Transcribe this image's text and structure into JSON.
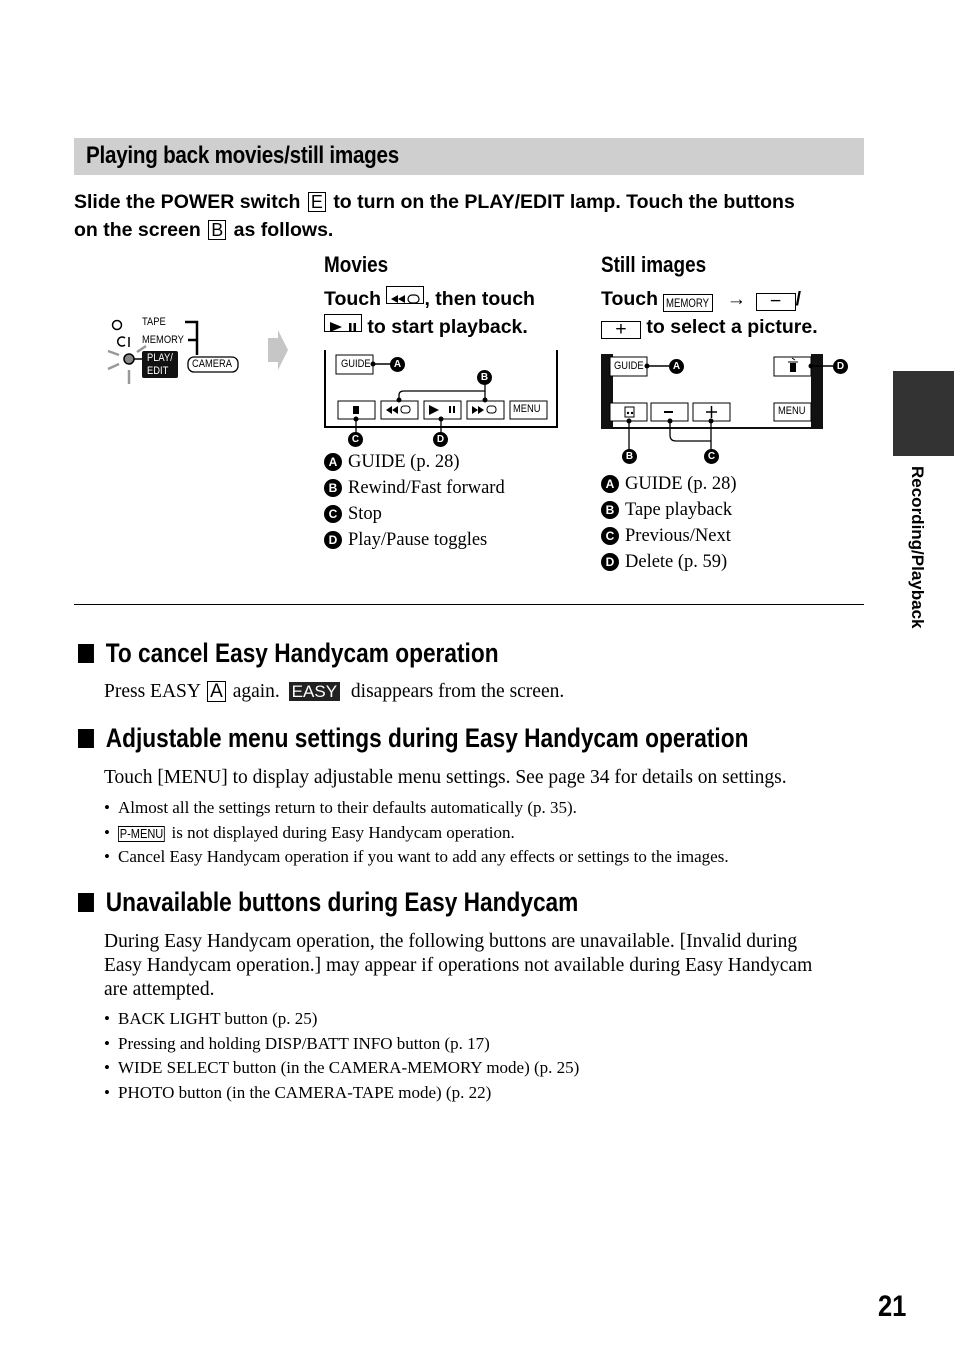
{
  "section": {
    "title": "Playing back movies/still images",
    "intro": {
      "part1": "Slide the POWER switch",
      "key1": "E",
      "part2": "to turn on the PLAY/EDIT lamp. Touch the buttons",
      "part3": "on the screen",
      "key2": "B",
      "part4": "as follows."
    }
  },
  "switch_diagram": {
    "labels": [
      "TAPE",
      "MEMORY",
      "PLAY/",
      "EDIT",
      "CAMERA"
    ],
    "arrow_icon": "right-arrow"
  },
  "movies": {
    "heading": "Movies",
    "instruction": {
      "touch": "Touch",
      "then": ", then touch",
      "after": "to start playback."
    },
    "screen": {
      "guide": "GUIDE",
      "menu": "MENU",
      "buttons": [
        "stop",
        "rewind",
        "play-pause",
        "fast-forward",
        "menu"
      ]
    },
    "callouts": [
      "A",
      "B",
      "C",
      "D"
    ],
    "legend": [
      {
        "badge": "A",
        "text": "GUIDE (p. 28)"
      },
      {
        "badge": "B",
        "text": "Rewind/Fast forward"
      },
      {
        "badge": "C",
        "text": "Stop"
      },
      {
        "badge": "D",
        "text": "Play/Pause toggles"
      }
    ]
  },
  "still_images": {
    "heading": "Still images",
    "instruction": {
      "touch": "Touch",
      "memory_chip": "MEMORY",
      "arrow": "→",
      "minus": "−",
      "slash": "/",
      "plus": "+",
      "after": "to select a picture."
    },
    "screen": {
      "guide": "GUIDE",
      "menu": "MENU",
      "minus": "−",
      "plus": "+"
    },
    "callouts": [
      "A",
      "B",
      "C",
      "D"
    ],
    "legend": [
      {
        "badge": "A",
        "text": "GUIDE (p. 28)"
      },
      {
        "badge": "B",
        "text": "Tape playback"
      },
      {
        "badge": "C",
        "text": "Previous/Next"
      },
      {
        "badge": "D",
        "text": "Delete (p. 59)"
      }
    ]
  },
  "cancel": {
    "heading": "To cancel Easy Handycam operation",
    "text1": "Press EASY",
    "key": "A",
    "text2": "again.",
    "chip": "EASY",
    "text3": "disappears from the screen."
  },
  "adjustable": {
    "heading": "Adjustable menu settings during Easy Handycam operation",
    "body": "Touch [MENU] to display adjustable menu settings. See page 34 for details on settings.",
    "bullets": [
      "Almost all the settings return to their defaults automatically (p. 35).",
      "is not displayed during Easy Handycam operation.",
      "Cancel Easy Handycam operation if you want to add any effects or settings to the images."
    ],
    "pmenu_chip": "P-MENU"
  },
  "unavailable": {
    "heading": "Unavailable buttons during Easy Handycam",
    "body_lines": [
      "During Easy Handycam operation, the following buttons are unavailable. [Invalid during",
      "Easy Handycam operation.] may appear if operations not available during Easy Handycam",
      "are attempted."
    ],
    "bullets": [
      "BACK LIGHT button (p. 25)",
      "Pressing and holding DISP/BATT INFO button (p. 17)",
      "WIDE SELECT button (in the CAMERA-MEMORY mode) (p. 25)",
      "PHOTO button (in the CAMERA-TAPE mode) (p. 22)"
    ]
  },
  "side_tab": "Recording/Playback",
  "page_number": "21",
  "colors": {
    "banner_bg": "#cfcfcf",
    "side_tab_bg": "#333333",
    "text": "#000000"
  }
}
